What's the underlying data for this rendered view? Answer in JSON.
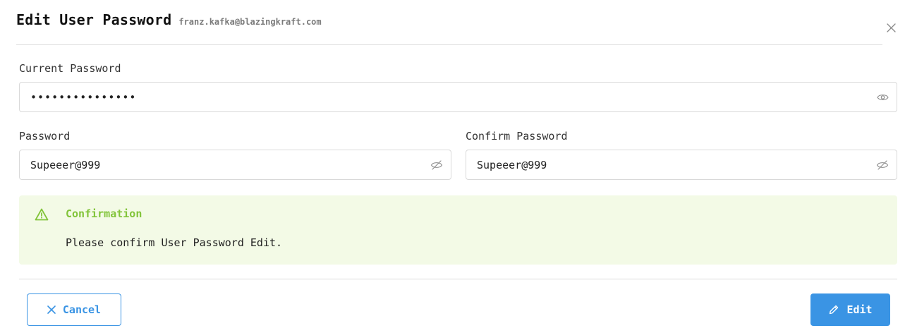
{
  "dialog": {
    "title": "Edit User Password",
    "subtitle": "franz.kafka@blazingkraft.com",
    "close_icon": "close-icon"
  },
  "current_password": {
    "label": "Current Password",
    "value": "•••••••••••••••",
    "visibility_icon": "eye-icon"
  },
  "password": {
    "label": "Password",
    "value": "Supeeer@999",
    "visibility_icon": "eye-off-icon"
  },
  "confirm_password": {
    "label": "Confirm Password",
    "value": "Supeeer@999",
    "visibility_icon": "eye-off-icon"
  },
  "alert": {
    "title": "Confirmation",
    "message": "Please confirm User Password Edit.",
    "icon": "warning-triangle-icon",
    "color": "#82c43a",
    "background": "#f3fae6"
  },
  "footer": {
    "cancel_label": "Cancel",
    "cancel_icon": "close-icon",
    "edit_label": "Edit",
    "edit_icon": "pencil-icon",
    "accent_color": "#3a94e4"
  }
}
